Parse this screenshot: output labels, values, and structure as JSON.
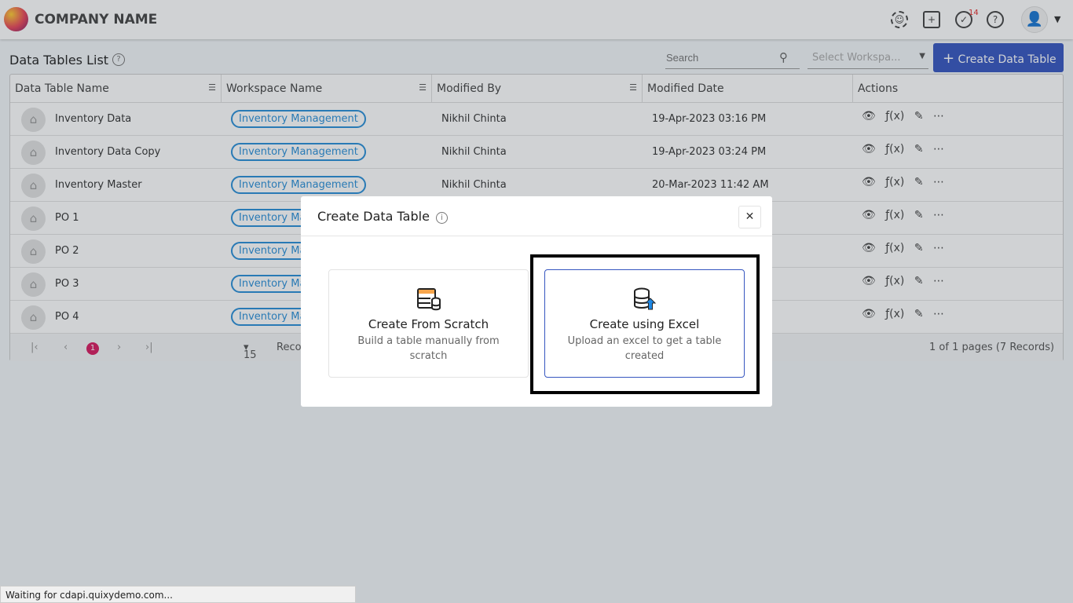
{
  "header": {
    "company": "COMPANY NAME",
    "notification_count": "14"
  },
  "page": {
    "title": "Data Tables List",
    "search_placeholder": "Search",
    "workspace_placeholder": "Select Workspa...",
    "create_button": "Create Data Table"
  },
  "table": {
    "columns": [
      "Data Table Name",
      "Workspace Name",
      "Modified By",
      "Modified Date",
      "Actions"
    ],
    "rows": [
      {
        "name": "Inventory Data",
        "workspace": "Inventory Management",
        "by": "Nikhil Chinta",
        "date": "19-Apr-2023 03:16 PM"
      },
      {
        "name": "Inventory Data Copy",
        "workspace": "Inventory Management",
        "by": "Nikhil Chinta",
        "date": "19-Apr-2023 03:24 PM"
      },
      {
        "name": "Inventory Master",
        "workspace": "Inventory Management",
        "by": "Nikhil Chinta",
        "date": "20-Mar-2023 11:42 AM"
      },
      {
        "name": "PO 1",
        "workspace": "Inventory Ma",
        "by": "",
        "date": ""
      },
      {
        "name": "PO 2",
        "workspace": "Inventory Ma",
        "by": "",
        "date": ""
      },
      {
        "name": "PO 3",
        "workspace": "Inventory Ma",
        "by": "",
        "date": ""
      },
      {
        "name": "PO 4",
        "workspace": "Inventory Ma",
        "by": "",
        "date": ""
      }
    ],
    "pager": {
      "current": "1",
      "page_size": "15",
      "records_label": "Reco",
      "summary": "1 of 1 pages (7 Records)"
    }
  },
  "modal": {
    "title": "Create Data Table",
    "options": [
      {
        "title": "Create From Scratch",
        "desc": "Build a table manually from scratch"
      },
      {
        "title": "Create using Excel",
        "desc": "Upload an excel to get a table created"
      }
    ]
  },
  "status_bar": "Waiting for cdapi.quixydemo.com...",
  "colors": {
    "accent": "#3656c0",
    "tag": "#2a8fd8",
    "page_badge": "#d81b60"
  }
}
